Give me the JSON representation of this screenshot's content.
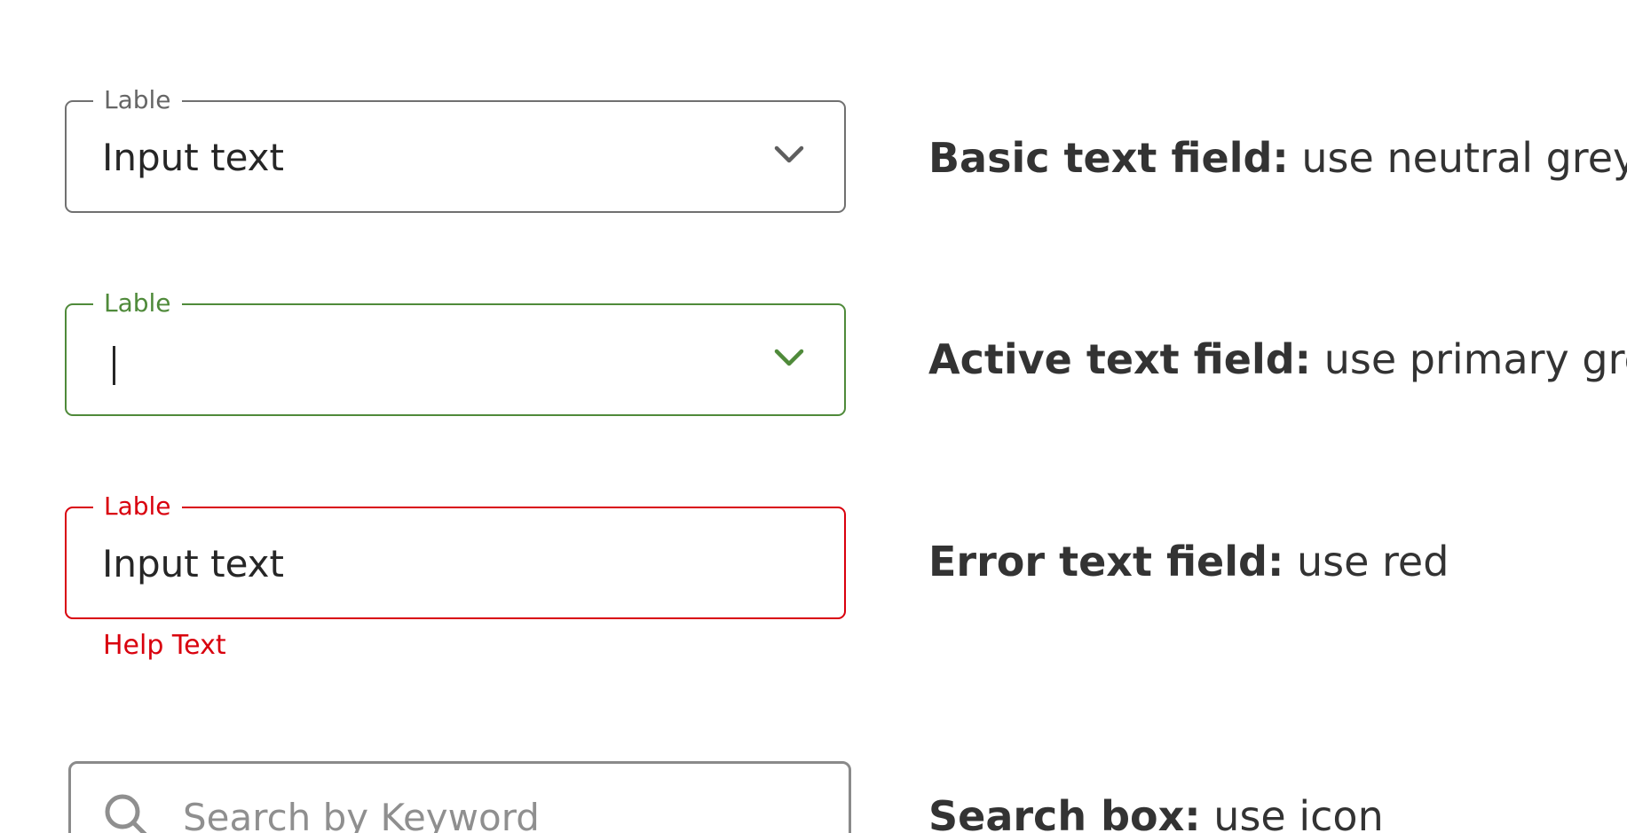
{
  "colors": {
    "neutral": "#707070",
    "primary_green": "#4f8a3a",
    "error_red": "#d9000d"
  },
  "fields": {
    "basic": {
      "label": "Lable",
      "value": "Input text",
      "icon": "chevron-down-icon"
    },
    "active": {
      "label": "Lable",
      "value": "",
      "icon": "chevron-down-icon"
    },
    "error": {
      "label": "Lable",
      "value": "Input text",
      "help": "Help Text"
    },
    "search": {
      "placeholder": "Search by Keyword",
      "icon": "search-icon"
    }
  },
  "descriptions": {
    "basic": {
      "title": "Basic text field:",
      "text": " use neutral grey"
    },
    "active": {
      "title": "Active text field:",
      "text": " use primary green"
    },
    "error": {
      "title": "Error text field:",
      "text": " use red"
    },
    "search": {
      "title": "Search box:",
      "text": " use icon"
    }
  }
}
